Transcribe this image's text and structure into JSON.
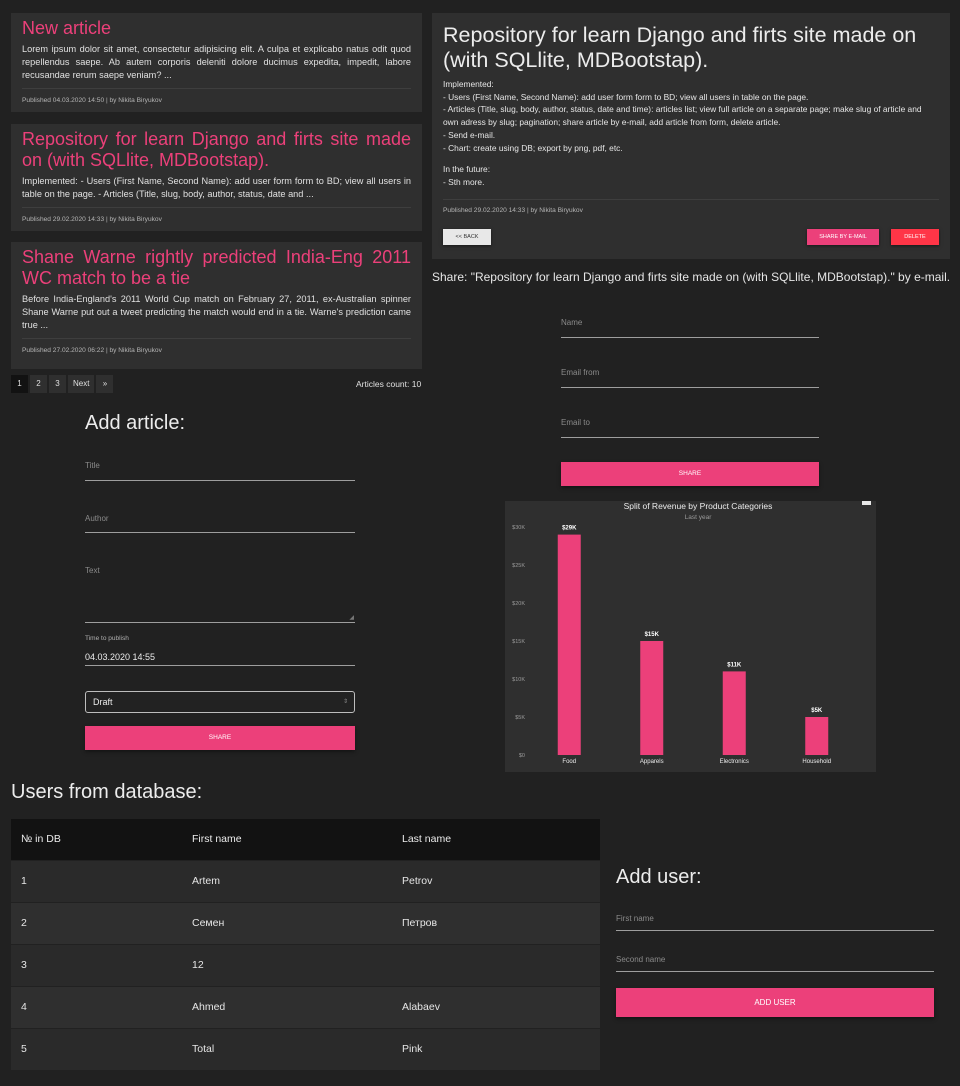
{
  "articles": [
    {
      "title": "New article",
      "excerpt": "Lorem ipsum dolor sit amet, consectetur adipisicing elit. A culpa et explicabo natus odit quod repellendus saepe. Ab autem corporis deleniti dolore ducimus expedita, impedit, labore recusandae rerum saepe veniam? ...",
      "meta": "Published 04.03.2020 14:50 | by Nikita Biryukov"
    },
    {
      "title": "Repository for learn Django and firts site made on (with SQLlite, MDBootstap).",
      "excerpt": "Implemented: - Users (First Name, Second Name): add user form form to BD; view all users in table on the page. - Articles (Title, slug, body, author, status, date and ...",
      "meta": "Published 29.02.2020 14:33 | by Nikita Biryukov"
    },
    {
      "title": "Shane Warne rightly predicted India-Eng 2011 WC match to be a tie",
      "excerpt": "Before India-England's 2011 World Cup match on February 27, 2011, ex-Australian spinner Shane Warne put out a tweet predicting the match would end in a tie. Warne's prediction came true ...",
      "meta": "Published 27.02.2020 06:22 | by Nikita Biryukov"
    }
  ],
  "pagination": {
    "pages": [
      "1",
      "2",
      "3"
    ],
    "next": "Next",
    "last": "»",
    "count": "Articles count: 10"
  },
  "detail": {
    "title": "Repository for learn Django and firts site made on (with SQLlite, MDBootstap).",
    "lines1": [
      "Implemented:",
      "- Users (First Name, Second Name): add user form form to BD; view all users in table on the page.",
      "- Articles (Title, slug, body, author, status, date and time): articles list; view full article on a separate page; make slug of article and own adress by slug; pagination; share article by e-mail, add article from form, delete article.",
      "- Send e-mail.",
      "- Chart: create using DB; export by png, pdf, etc."
    ],
    "lines2": [
      "In the future:",
      "- Sth more."
    ],
    "meta": "Published 29.02.2020 14:33 | by Nikita Biryukov",
    "back": "<< BACK",
    "share": "SHARE BY E-MAIL",
    "delete": "DELETE"
  },
  "share_form": {
    "heading": "Share: \"Repository for learn Django and firts site made on (with SQLlite, MDBootstap).\" by e-mail.",
    "name": "Name",
    "email_from": "Email from",
    "email_to": "Email to",
    "submit": "SHARE"
  },
  "add_article": {
    "heading": "Add article:",
    "title": "Title",
    "author": "Author",
    "text": "Text",
    "time_label": "Time to publish",
    "time_value": "04.03.2020 14:55",
    "status": "Draft",
    "submit": "SHARE"
  },
  "chart_data": {
    "type": "bar",
    "title": "Split of Revenue by Product Categories",
    "subtitle": "Last year",
    "categories": [
      "Food",
      "Apparels",
      "Electronics",
      "Household"
    ],
    "values": [
      29,
      15,
      11,
      5
    ],
    "data_labels": [
      "$29K",
      "$15K",
      "$11K",
      "$5K"
    ],
    "ylim": [
      0,
      30
    ],
    "yticks": [
      "$0",
      "$5K",
      "$10K",
      "$15K",
      "$20K",
      "$25K",
      "$30K"
    ],
    "bar_color": "#ec407a"
  },
  "users": {
    "heading": "Users from database:",
    "columns": [
      "№ in DB",
      "First name",
      "Last name"
    ],
    "rows": [
      [
        "1",
        "Artem",
        "Petrov"
      ],
      [
        "2",
        "Семен",
        "Петров"
      ],
      [
        "3",
        "12",
        ""
      ],
      [
        "4",
        "Ahmed",
        "Alabaev"
      ],
      [
        "5",
        "Total",
        "Pink"
      ]
    ]
  },
  "add_user": {
    "heading": "Add user:",
    "first_name": "First name",
    "second_name": "Second name",
    "submit": "ADD USER"
  },
  "colors": {
    "accent": "#ec407a",
    "danger": "#ff3547",
    "background": "#212121",
    "card": "#2f2f2f"
  }
}
